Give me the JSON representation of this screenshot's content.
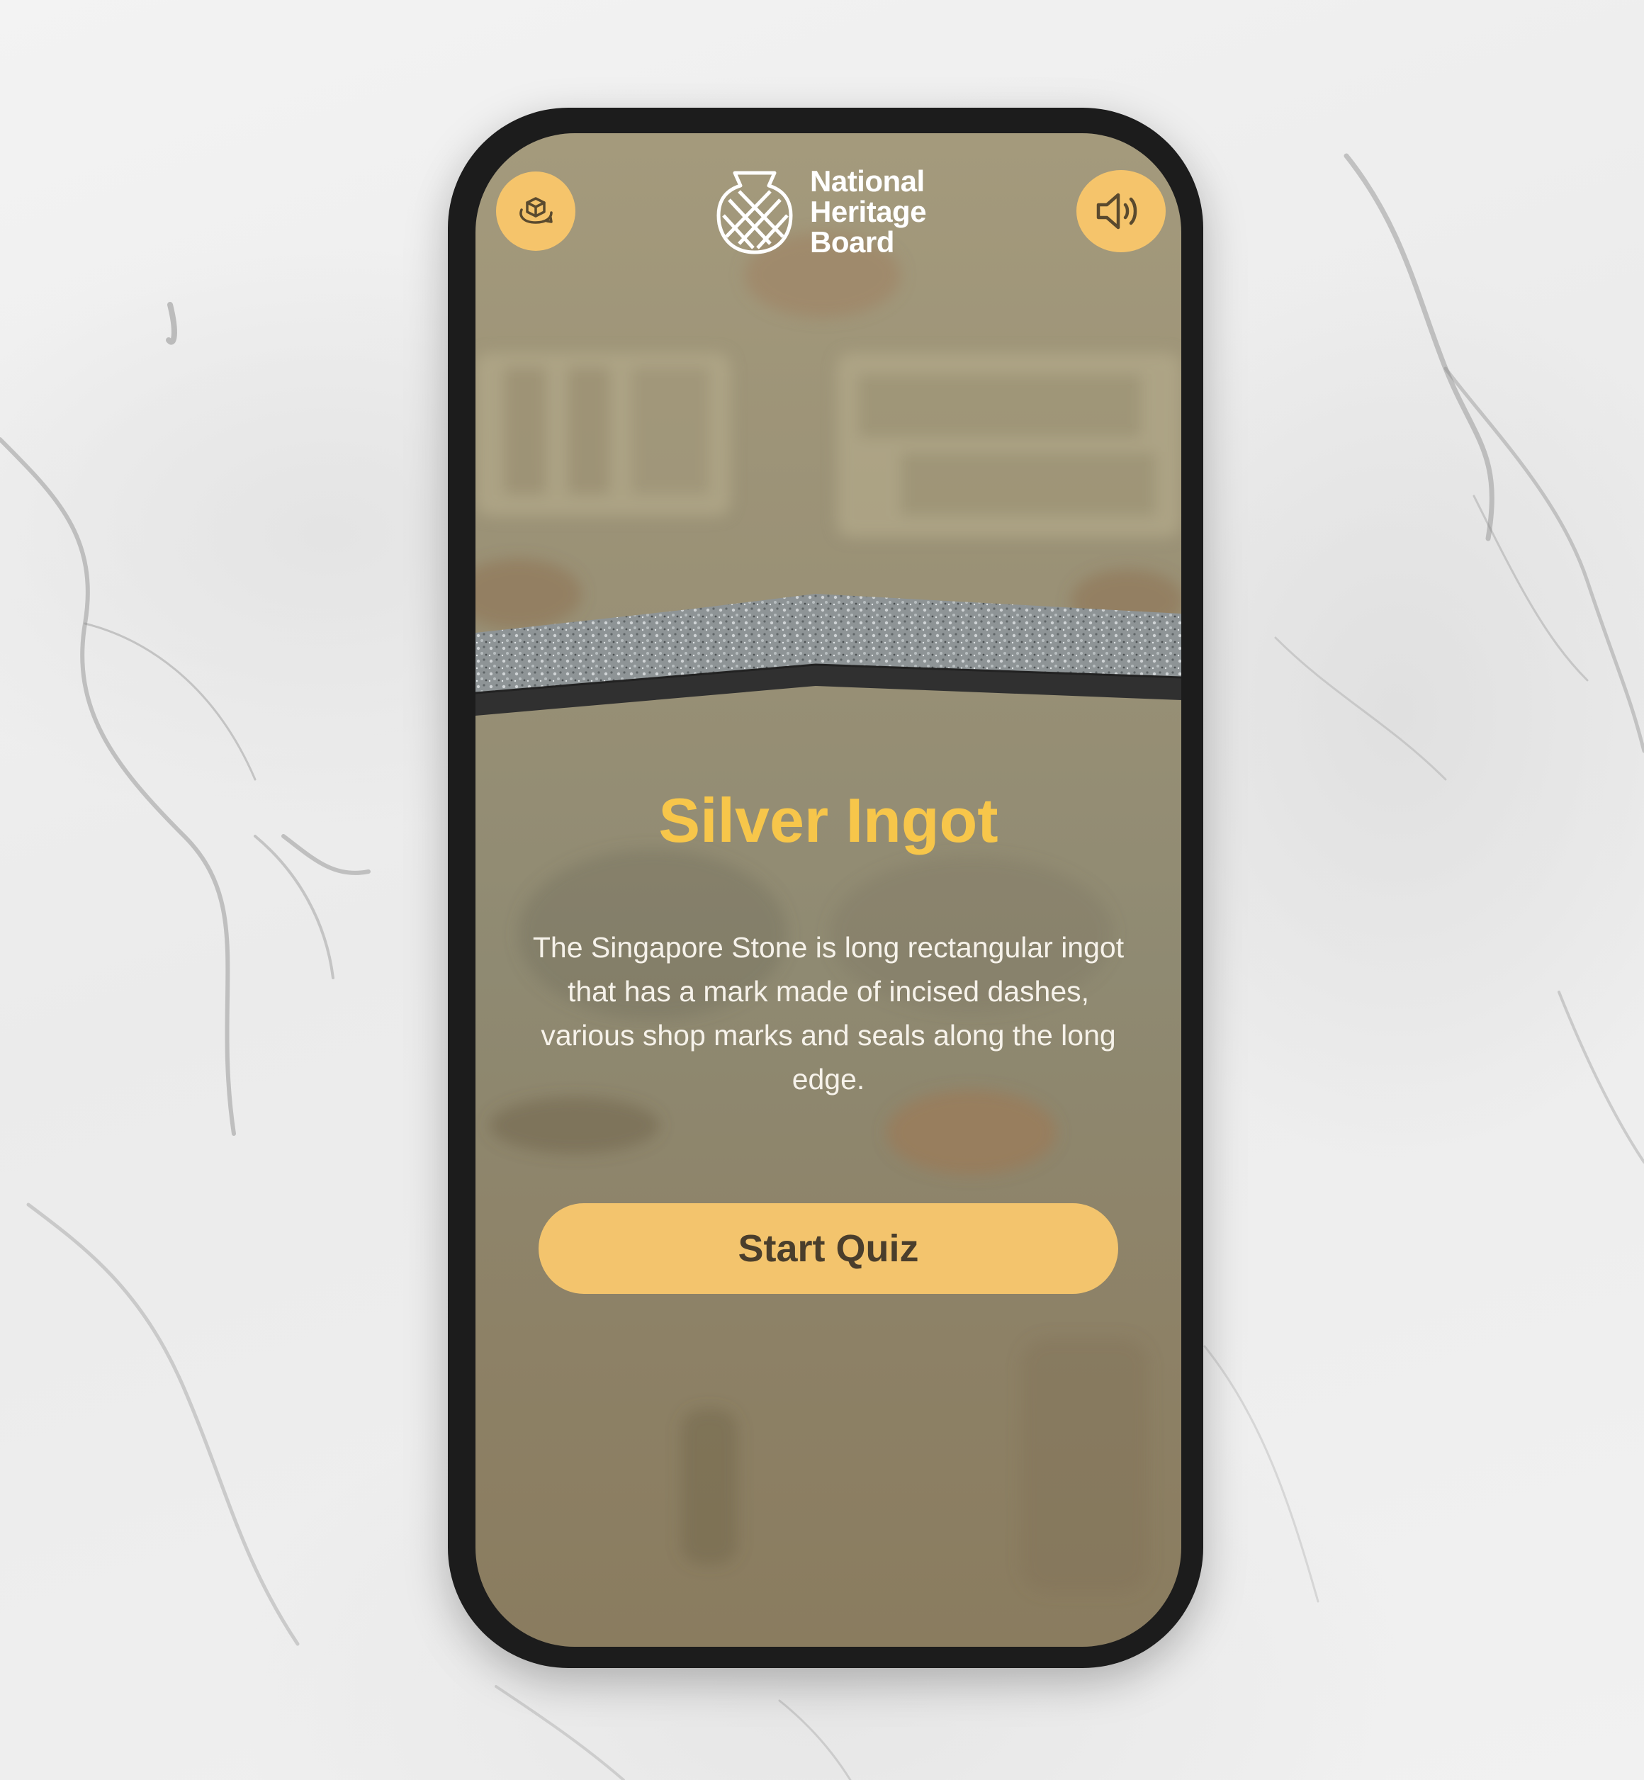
{
  "header": {
    "ar_icon": "ar-cube-rotate-icon",
    "sound_icon": "speaker-volume-icon",
    "logo": {
      "icon": "nhb-woven-vase-logo",
      "line1": "National",
      "line2": "Heritage",
      "line3": "Board"
    }
  },
  "artifact": {
    "title": "Silver Ingot",
    "description": "The Singapore Stone is long rectangular ingot that has a mark made of incised dashes, various shop marks and seals along the long edge."
  },
  "actions": {
    "start_quiz_label": "Start Quiz"
  },
  "colors": {
    "accent": "#f5c46b",
    "title": "#f7c64a",
    "overlay": "#9a9176",
    "phone_frame": "#1c1c1c"
  }
}
